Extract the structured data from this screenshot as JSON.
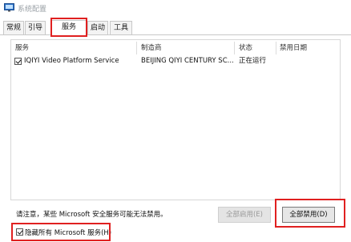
{
  "window": {
    "title": "系统配置",
    "icon": "monitor-icon"
  },
  "tabs": [
    {
      "label": "常规",
      "active": false
    },
    {
      "label": "引导",
      "active": false
    },
    {
      "label": "服务",
      "active": true
    },
    {
      "label": "启动",
      "active": false
    },
    {
      "label": "工具",
      "active": false
    }
  ],
  "services": {
    "columns": [
      "服务",
      "制造商",
      "状态",
      "禁用日期"
    ],
    "rows": [
      {
        "checked": true,
        "service": "IQIYI Video Platform Service",
        "manufacturer": "BEIJING QIYI CENTURY SC...",
        "status": "正在运行",
        "disabled_date": ""
      }
    ]
  },
  "footer": {
    "notice": "请注意，某些 Microsoft 安全服务可能无法禁用。",
    "enable_all": "全部启用(E)",
    "disable_all": "全部禁用(D)",
    "hide_ms_label": "隐藏所有 Microsoft 服务(H)",
    "hide_ms_checked": true
  },
  "colors": {
    "highlight": "#e02020",
    "disabled_text": "#9a9a9a"
  }
}
